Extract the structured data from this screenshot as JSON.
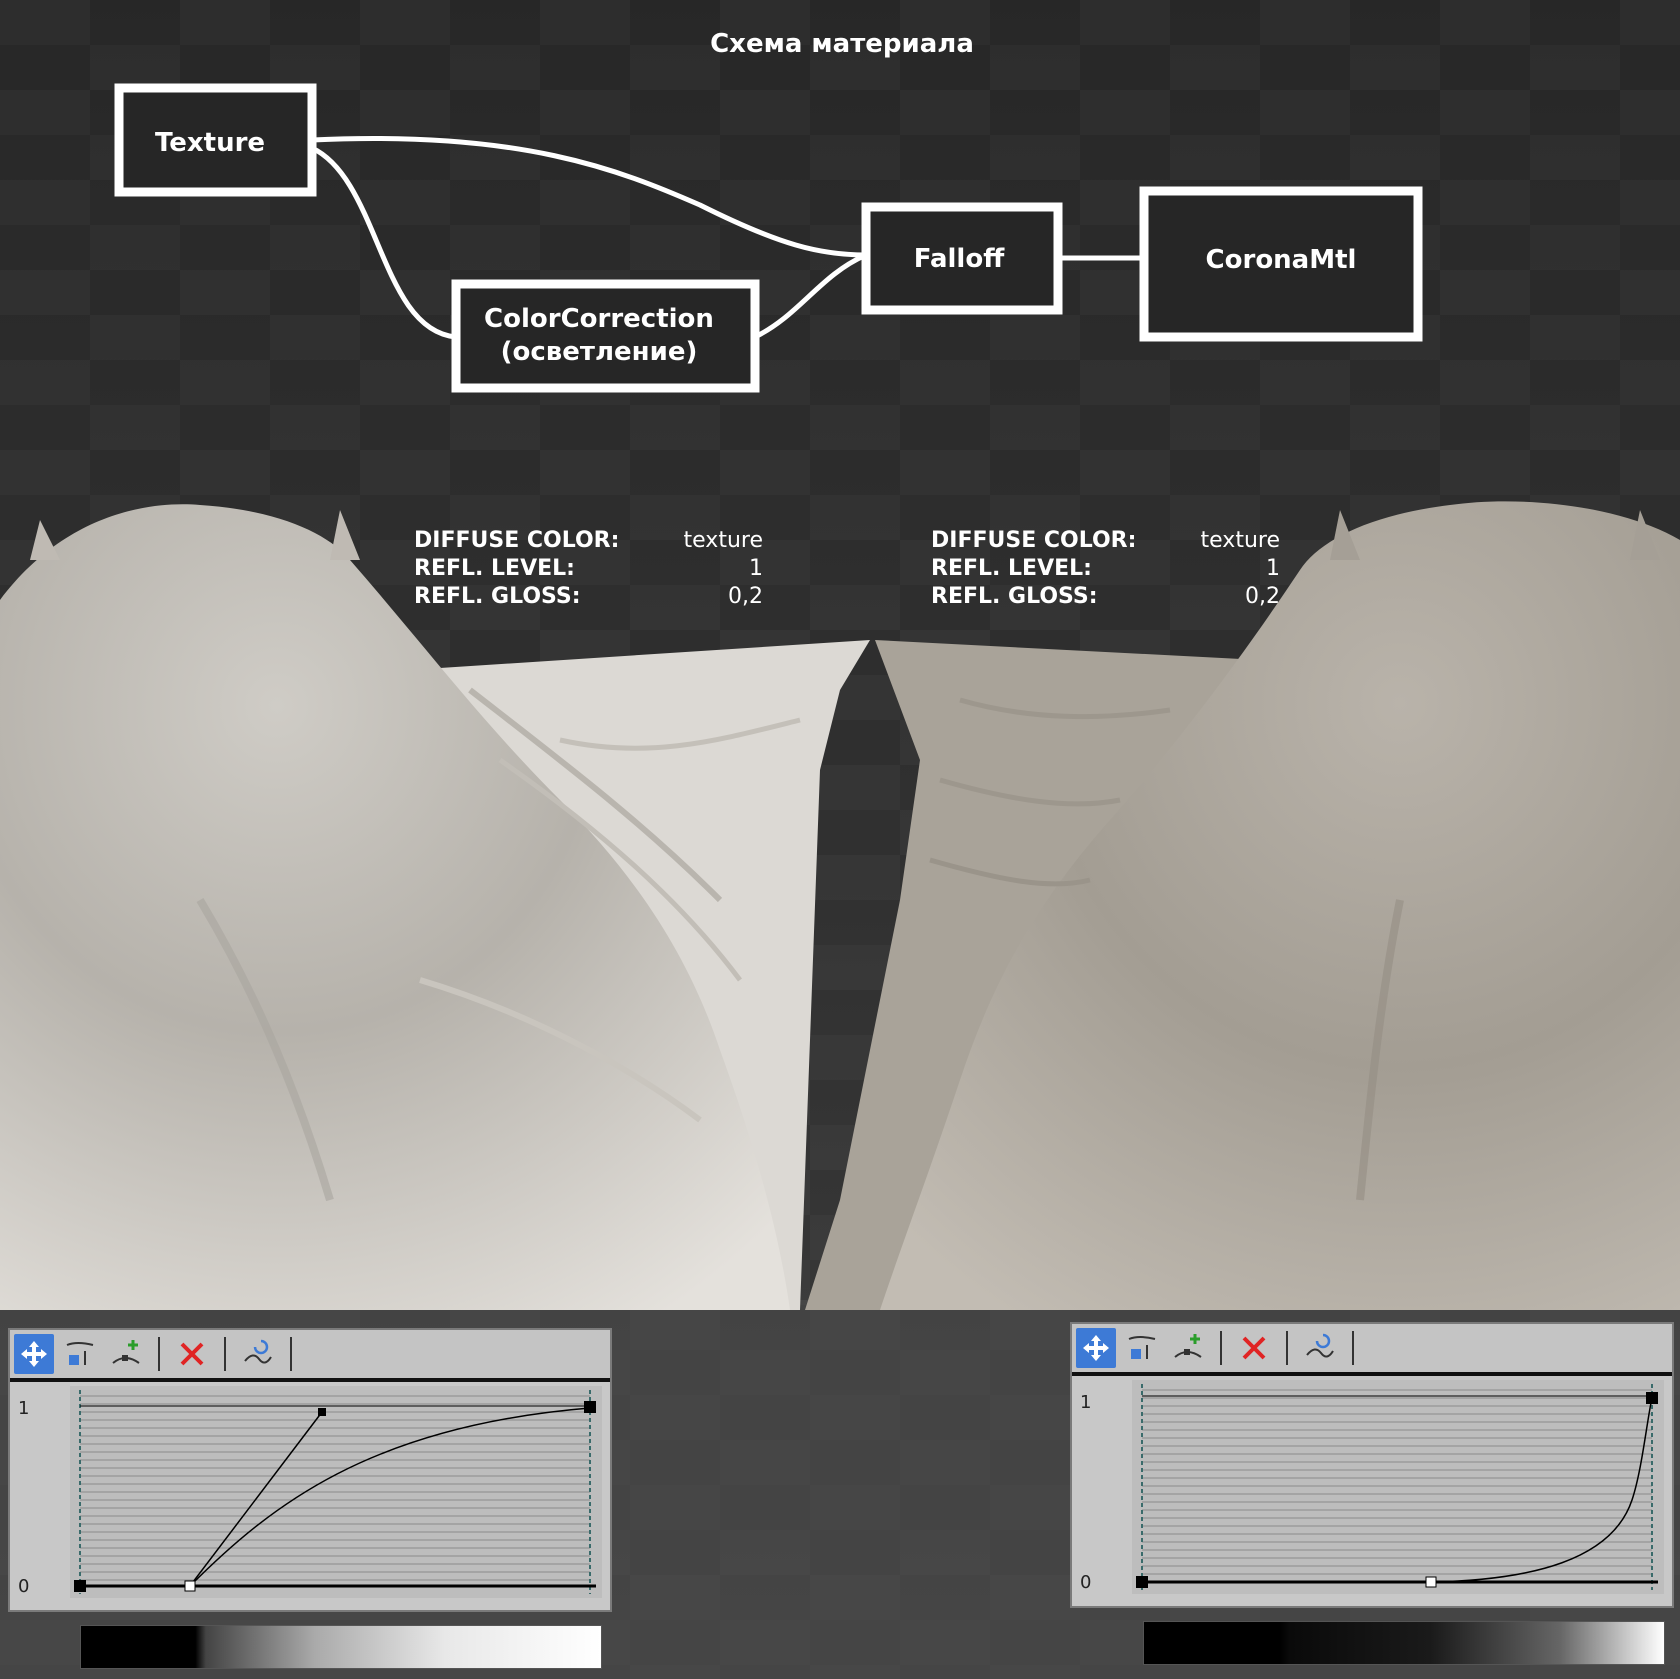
{
  "title": "Схема материала",
  "nodes": {
    "texture": "Texture",
    "colorcorrection_line1": "ColorCorrection",
    "colorcorrection_line2": "(осветление)",
    "falloff": "Falloff",
    "coronamtl": "CoronaMtl"
  },
  "params_left": [
    {
      "key": "DIFFUSE COLOR:",
      "value": "texture"
    },
    {
      "key": "REFL. LEVEL:",
      "value": "1"
    },
    {
      "key": "REFL. GLOSS:",
      "value": "0,2"
    }
  ],
  "params_right": [
    {
      "key": "DIFFUSE COLOR:",
      "value": "texture"
    },
    {
      "key": "REFL. LEVEL:",
      "value": "1"
    },
    {
      "key": "REFL. GLOSS:",
      "value": "0,2"
    }
  ],
  "curve_left": {
    "axis_max": "1",
    "axis_min": "0"
  },
  "curve_right": {
    "axis_max": "1",
    "axis_min": "0"
  },
  "colors": {
    "background": "#2b2b2b",
    "checker_light": "#3a3a3a",
    "node_border": "#ffffff",
    "cloth_light": "#dedbd6",
    "cloth_dark": "#a8a298",
    "toolbar_active": "#3d7ad6"
  },
  "icons": [
    "move-icon",
    "scale-point-icon",
    "insert-point-icon",
    "delete-icon",
    "reset-curve-icon"
  ]
}
